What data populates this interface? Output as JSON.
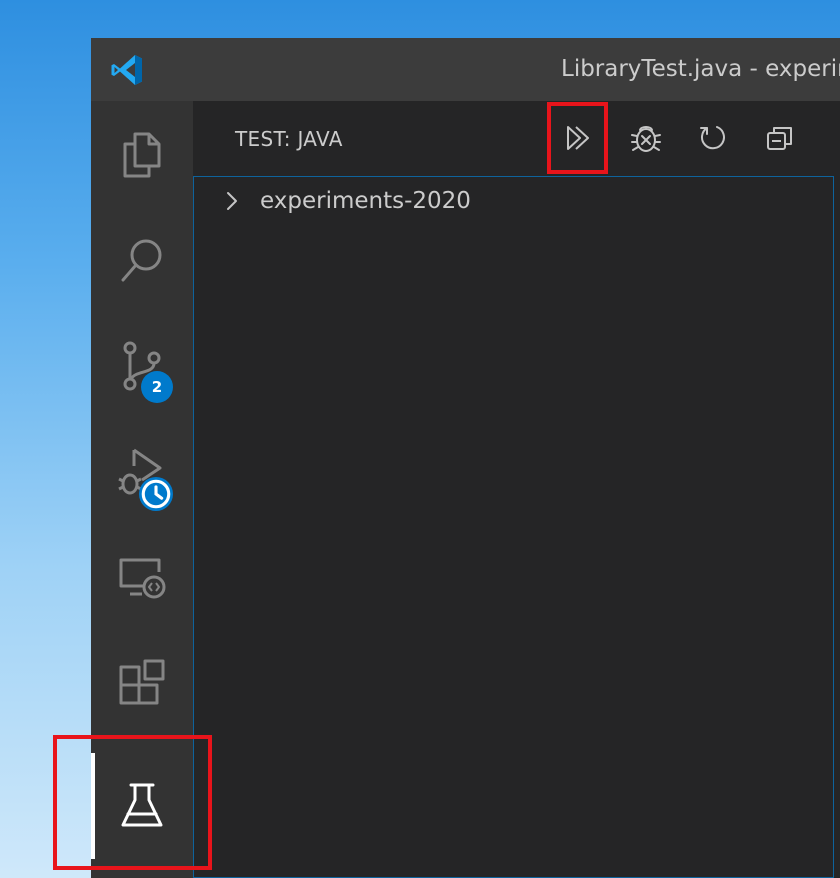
{
  "window": {
    "title": "LibraryTest.java - experim",
    "logo_icon": "vscode-logo-icon"
  },
  "activity_bar": {
    "items": [
      {
        "name": "explorer",
        "icon": "files-icon"
      },
      {
        "name": "search",
        "icon": "search-icon"
      },
      {
        "name": "source-control",
        "icon": "source-control-icon",
        "badge": "2"
      },
      {
        "name": "run-debug",
        "icon": "run-debug-icon",
        "badge_icon": "clock-icon"
      },
      {
        "name": "remote-explorer",
        "icon": "remote-explorer-icon"
      },
      {
        "name": "extensions",
        "icon": "extensions-icon"
      },
      {
        "name": "testing",
        "icon": "beaker-icon",
        "active": true
      }
    ]
  },
  "sidebar": {
    "title": "TEST: JAVA",
    "toolbar": [
      "run-all-tests-icon",
      "debug-all-tests-icon",
      "refresh-icon",
      "collapse-all-icon"
    ],
    "tree": [
      {
        "label": "experiments-2020",
        "expanded": false
      }
    ]
  },
  "colors": {
    "accent": "#007acc",
    "highlight": "#e8141b",
    "sidebar_bg": "#252526",
    "activitybar_bg": "#333333",
    "titlebar_bg": "#3c3c3c"
  }
}
